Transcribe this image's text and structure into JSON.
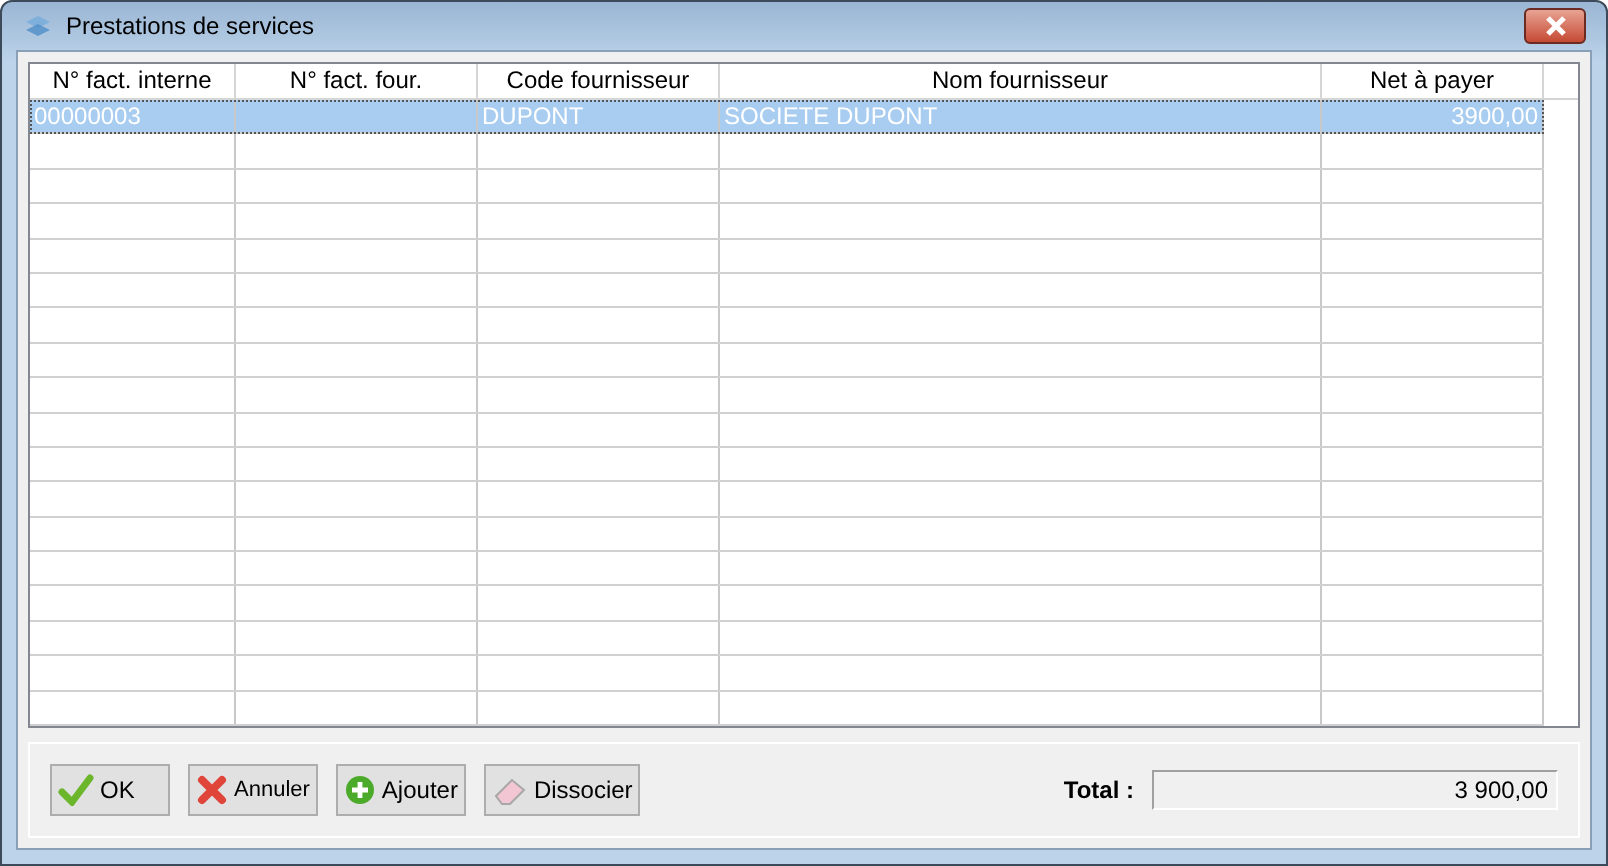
{
  "window": {
    "title": "Prestations de services"
  },
  "table": {
    "columns": [
      "N° fact. interne",
      "N° fact. four.",
      "Code fournisseur",
      "Nom fournisseur",
      "Net à payer"
    ],
    "rows": [
      {
        "cells": [
          "00000003",
          "",
          "DUPONT",
          "SOCIETE DUPONT",
          "3900,00"
        ],
        "selected": true
      }
    ]
  },
  "buttons": [
    {
      "kind": "ok",
      "label": "OK"
    },
    {
      "kind": "cancel",
      "label": "Annuler"
    },
    {
      "kind": "add",
      "label": "Ajouter"
    },
    {
      "kind": "detach",
      "label": "Dissocier"
    }
  ],
  "total": {
    "label": "Total :",
    "value": "3 900,00"
  }
}
